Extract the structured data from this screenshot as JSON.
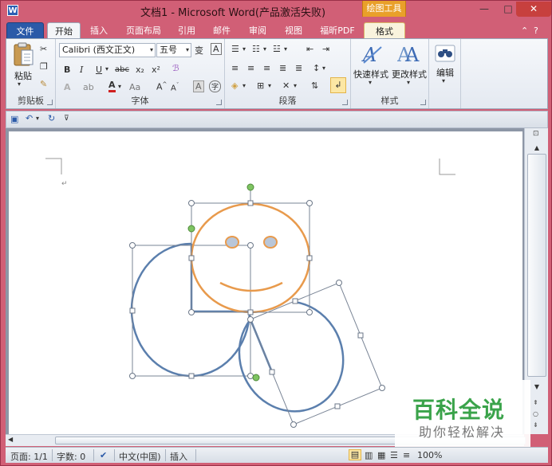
{
  "window": {
    "title": "文档1 - Microsoft Word(产品激活失败)",
    "app_icon": "W",
    "context_tab_group": "绘图工具",
    "controls": {
      "minimize": "—",
      "maximize": "□",
      "close": "✕"
    }
  },
  "tabs": [
    {
      "label": "文件"
    },
    {
      "label": "开始"
    },
    {
      "label": "插入"
    },
    {
      "label": "页面布局"
    },
    {
      "label": "引用"
    },
    {
      "label": "邮件"
    },
    {
      "label": "审阅"
    },
    {
      "label": "视图"
    },
    {
      "label": "福昕PDF"
    },
    {
      "label": "格式"
    }
  ],
  "ribbon": {
    "clipboard": {
      "paste": "粘贴",
      "label": "剪贴板"
    },
    "font": {
      "font_name": "Calibri (西文正文)",
      "font_size": "五号",
      "label": "字体",
      "bold": "B",
      "italic": "I",
      "underline": "U",
      "strike": "abc",
      "sub": "x₂",
      "sup": "x²",
      "color_a": "A",
      "aa": "Aa",
      "grow": "A",
      "shrink": "A"
    },
    "paragraph": {
      "label": "段落"
    },
    "styles": {
      "quick_styles": "快速样式",
      "change_styles": "更改样式",
      "label": "样式"
    },
    "editing": {
      "label": "编辑"
    }
  },
  "statusbar": {
    "page": "页面: 1/1",
    "words": "字数: 0",
    "language": "中文(中国)",
    "mode": "插入",
    "zoom": "100%"
  },
  "watermark": {
    "title": "百科全说",
    "subtitle": "助你轻松解决"
  },
  "colors": {
    "shape_blue": "#5b7fad",
    "smiley_orange": "#e89a4c",
    "handle_green": "#7ec462"
  }
}
